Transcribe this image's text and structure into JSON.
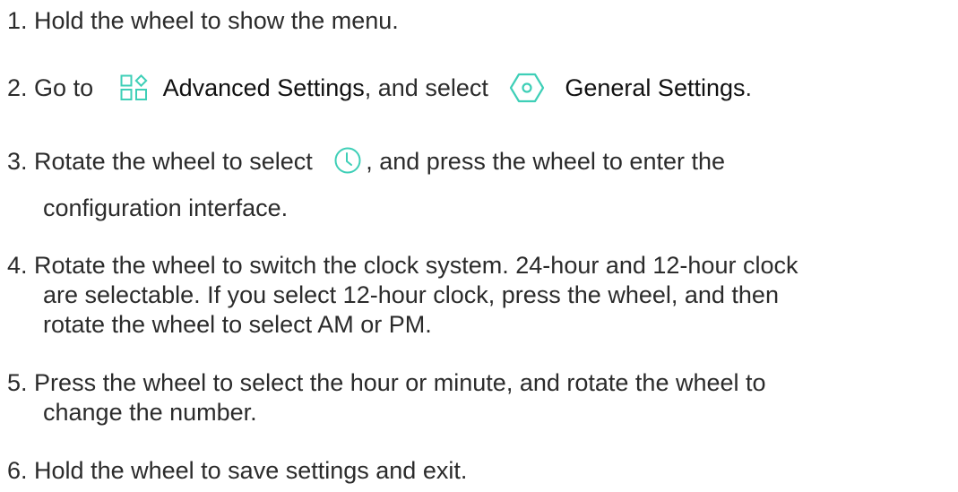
{
  "steps": [
    {
      "number": "1.",
      "text": "Hold the wheel to show the menu."
    },
    {
      "number": "2.",
      "text_go": "Go to",
      "advanced_icon": "advanced-settings-icon",
      "advanced_label": "Advanced Settings",
      "text_select": ", and select",
      "general_icon": "general-settings-icon",
      "general_label": "General Settings",
      "period": "."
    },
    {
      "number": "3.",
      "text_before": "Rotate the wheel to select",
      "clock_icon": "clock-icon",
      "text_after": ", and press the wheel to enter the",
      "line2": "configuration interface."
    },
    {
      "number": "4.",
      "line1": "Rotate the wheel to switch the clock system. 24-hour and 12-hour clock",
      "line2": "are selectable. If you select 12-hour clock, press the wheel, and then",
      "line3": "rotate the wheel to select AM or PM."
    },
    {
      "number": "5.",
      "line1": "Press the wheel to select the hour or minute, and rotate the wheel to",
      "line2": "change the number."
    },
    {
      "number": "6.",
      "text": "Hold the wheel to save settings and exit."
    }
  ],
  "colors": {
    "icon_teal": "#3ecfb7",
    "text": "#2b2b2b"
  }
}
